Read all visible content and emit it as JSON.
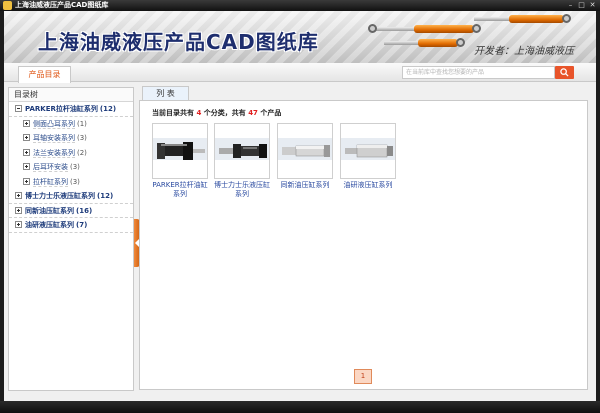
{
  "window": {
    "title": "上海油威液压产品CAD图纸库",
    "controls": [
      "–",
      "□",
      "✕"
    ]
  },
  "banner": {
    "title": "上海油威液压产品CAD图纸库",
    "developer": "开发者：上海油威液压"
  },
  "tabs": {
    "catalog": "产品目录",
    "list": "列 表"
  },
  "search": {
    "placeholder": "在当前库中查找您想要的产品"
  },
  "tree": {
    "header": "目录树",
    "items": [
      {
        "label": "PARKER拉杆油缸系列",
        "count": "(12)",
        "level": 0,
        "expanded": true
      },
      {
        "label": "侧面凸耳系列",
        "count": "(1)",
        "level": 1
      },
      {
        "label": "耳轴安装系列",
        "count": "(3)",
        "level": 1
      },
      {
        "label": "法兰安装系列",
        "count": "(2)",
        "level": 1
      },
      {
        "label": "后耳环安装",
        "count": "(3)",
        "level": 1
      },
      {
        "label": "拉杆缸系列",
        "count": "(3)",
        "level": 1
      },
      {
        "label": "博士力士乐液压缸系列",
        "count": "(12)",
        "level": 0,
        "expanded": false
      },
      {
        "label": "同新油压缸系列",
        "count": "(16)",
        "level": 0,
        "expanded": false
      },
      {
        "label": "油研液压缸系列",
        "count": "(7)",
        "level": 0,
        "expanded": false
      }
    ]
  },
  "summary": {
    "prefix": "当前目录共有",
    "categories": "4",
    "middle": "个分类，共有",
    "products": "47",
    "suffix": "个产品"
  },
  "products": [
    {
      "label": "PARKER拉杆油缸系列"
    },
    {
      "label": "博士力士乐液压缸系列"
    },
    {
      "label": "同新油压缸系列"
    },
    {
      "label": "油研液压缸系列"
    }
  ],
  "pagination": {
    "current": "1"
  },
  "colors": {
    "accent": "#e8542a",
    "link": "#2a4aa0",
    "tree_text": "#1c3a7a",
    "highlight_number": "#e02020"
  }
}
